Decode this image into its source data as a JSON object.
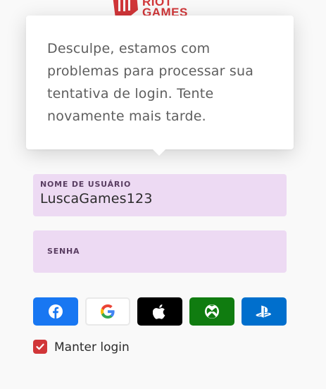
{
  "brand": {
    "logo_text": "RIOT\nGAMES",
    "accent_color": "#d13639"
  },
  "error_tooltip": {
    "message": "Desculpe, estamos com problemas para processar sua tentativa de login. Tente novamente mais tarde."
  },
  "form": {
    "username": {
      "label": "NOME DE USUÁRIO",
      "value": "LuscaGames123",
      "background": "#eddaf3"
    },
    "password": {
      "label": "SENHA",
      "value": ""
    }
  },
  "social_login": [
    {
      "name": "facebook",
      "icon": "facebook-icon",
      "color": "#1877f2"
    },
    {
      "name": "google",
      "icon": "google-icon",
      "color": "#ffffff"
    },
    {
      "name": "apple",
      "icon": "apple-icon",
      "color": "#000000"
    },
    {
      "name": "xbox",
      "icon": "xbox-icon",
      "color": "#107c10"
    },
    {
      "name": "playstation",
      "icon": "playstation-icon",
      "color": "#006fcd"
    }
  ],
  "remember": {
    "label": "Manter login",
    "checked": true
  }
}
